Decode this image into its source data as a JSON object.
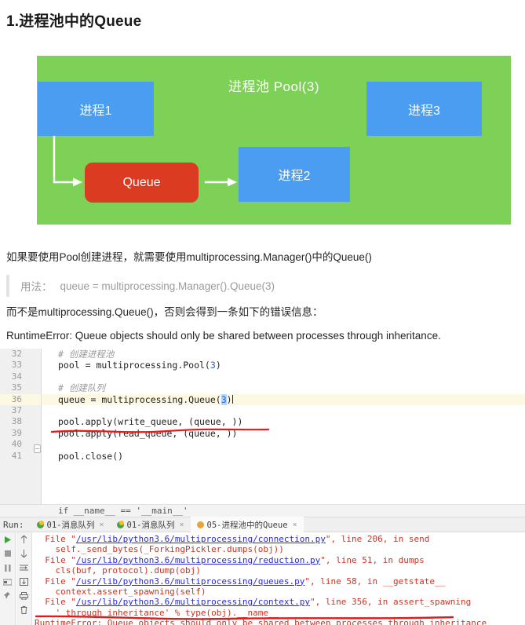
{
  "page_title": "1.进程池中的Queue",
  "diagram": {
    "pool_label": "进程池 Pool(3)",
    "proc1": "进程1",
    "proc2": "进程2",
    "proc3": "进程3",
    "queue": "Queue",
    "colors": {
      "pool_green": "#7ed157",
      "process_blue": "#4a9df0",
      "queue_red": "#db3b21",
      "arrow_white": "#ffffff"
    }
  },
  "body": {
    "para1": "如果要使用Pool创建进程，就需要使用multiprocessing.Manager()中的Queue()",
    "quote_label": "用法：",
    "quote_code": "queue = multiprocessing.Manager().Queue(3)",
    "para2": "而不是multiprocessing.Queue()，否则会得到一条如下的错误信息：",
    "para3": "RuntimeError: Queue objects should only be shared between processes through inheritance."
  },
  "editor": {
    "line_numbers": [
      "32",
      "33",
      "34",
      "35",
      "36",
      "37",
      "38",
      "39",
      "40",
      "41"
    ],
    "highlight_line": "36",
    "lines": [
      {
        "n": "32",
        "text": "# 创建进程池",
        "kind": "comment"
      },
      {
        "n": "33",
        "text": "pool = multiprocessing.Pool(3)",
        "kind": "code"
      },
      {
        "n": "34",
        "text": "",
        "kind": "blank"
      },
      {
        "n": "35",
        "text": "# 创建队列",
        "kind": "comment"
      },
      {
        "n": "36",
        "text": "queue = multiprocessing.Queue(3)",
        "kind": "code-highlight"
      },
      {
        "n": "37",
        "text": "",
        "kind": "blank"
      },
      {
        "n": "38",
        "text": "pool.apply(write_queue, (queue, ))",
        "kind": "code"
      },
      {
        "n": "39",
        "text": "pool.apply(read_queue, (queue, ))",
        "kind": "code"
      },
      {
        "n": "40",
        "text": "",
        "kind": "blank"
      },
      {
        "n": "41",
        "text": "pool.close()",
        "kind": "code"
      }
    ],
    "tail_line": "if __name__ == '__main__'"
  },
  "run_panel": {
    "label": "Run:",
    "tabs": [
      {
        "label": "01-消息队列",
        "active": false
      },
      {
        "label": "01-消息队列",
        "active": false
      },
      {
        "label": "05-进程池中的Queue",
        "active": true
      }
    ],
    "close_glyph": "×",
    "tool_icons_left": [
      "run-icon",
      "stop-icon",
      "pause-icon",
      "restart-icon",
      "pin-icon"
    ],
    "tool_icons_right": [
      "scroll-up-icon",
      "scroll-down-icon",
      "soft-wrap-icon",
      "scroll-to-end-icon",
      "print-icon",
      "trash-icon"
    ],
    "console_lines": [
      "  File \"/usr/lib/python3.6/multiprocessing/connection.py\", line 206, in send",
      "    self._send_bytes(_ForkingPickler.dumps(obj))",
      "  File \"/usr/lib/python3.6/multiprocessing/reduction.py\", line 51, in dumps",
      "    cls(buf, protocol).dump(obj)",
      "  File \"/usr/lib/python3.6/multiprocessing/queues.py\", line 58, in __getstate__",
      "    context.assert_spawning(self)",
      "  File \"/usr/lib/python3.6/multiprocessing/context.py\", line 356, in assert_spawning",
      "    ' through inheritance' % type(obj).__name__",
      "RuntimeError: Queue objects should only be shared between processes through inheritance"
    ]
  }
}
